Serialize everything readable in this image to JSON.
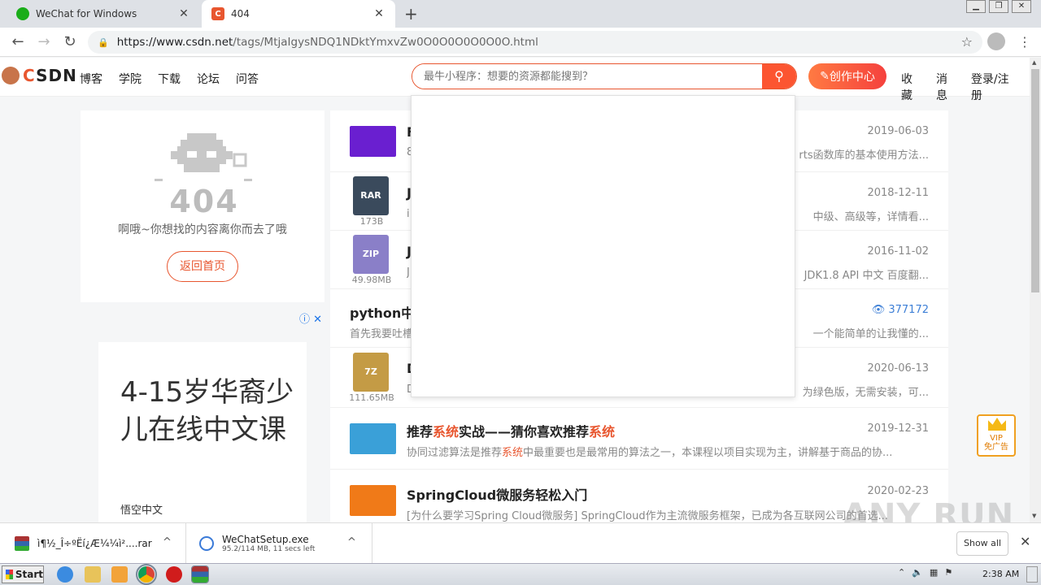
{
  "browser": {
    "tabs": [
      {
        "title": "WeChat for Windows"
      },
      {
        "title": "404"
      }
    ],
    "url_host": "https://www.csdn.net",
    "url_path": "/tags/MtjaIgysNDQ1NDktYmxvZw0O0O0O0O0O0O.html"
  },
  "header": {
    "logo": "CSDN",
    "nav": [
      "博客",
      "学院",
      "下载",
      "论坛",
      "问答"
    ],
    "search_placeholder": "最牛小程序：想要的资源都能搜到？",
    "create_label": "创作中心",
    "right_links": [
      "收藏",
      "消息",
      "登录/注册"
    ]
  },
  "error_card": {
    "code": "404",
    "message": "啊哦~你想找的内容离你而去了哦",
    "home_button": "返回首页"
  },
  "ad": {
    "headline": "4-15岁华裔少儿在线中文课",
    "brand": "悟空中文"
  },
  "results": [
    {
      "title": "F",
      "desc": "8",
      "desc_tail": "rts函数库的基本使用方法...",
      "date": "2019-06-03",
      "thumb_color": "#6a1fd0"
    },
    {
      "title": "J",
      "desc": "i",
      "desc_tail": "中级、高级等，详情看...",
      "date": "2018-12-11",
      "file_type": "RAR",
      "file_size": "173B",
      "file_color": "#3a4a5c"
    },
    {
      "title": "J",
      "desc": "J",
      "desc_tail": "JDK1.8 API 中文 百度翻...",
      "date": "2016-11-02",
      "file_type": "ZIP",
      "file_size": "49.98MB",
      "file_color": "#8a7fc8"
    },
    {
      "title": "python中",
      "desc": "首先我要吐槽",
      "desc_tail": "一个能简单的让我懂的...",
      "views": "377172"
    },
    {
      "title": "D",
      "desc": "D",
      "desc_tail": "为绿色版，无需安装，可...",
      "date": "2020-06-13",
      "file_type": "7Z",
      "file_size": "111.65MB",
      "file_color": "#c49b45"
    },
    {
      "title_parts": [
        "推荐",
        "系统",
        "实战——猜你喜欢推荐",
        "系统"
      ],
      "desc_parts": [
        "协同过滤算法是推荐",
        "系统",
        "中最重要也是最常用的算法之一，本课程以项目实现为主，讲解基于商品的协..."
      ],
      "date": "2019-12-31",
      "thumb_color": "#3aa0d8"
    },
    {
      "title": "SpringCloud微服务轻松入门",
      "desc": "[为什么要学习Spring Cloud微服务] SpringCloud作为主流微服务框架，已成为各互联网公司的首选...",
      "date": "2020-02-23",
      "thumb_color": "#f07a18"
    }
  ],
  "vip_badge": "VIP\n免广告",
  "downloads": [
    {
      "name": "ì¶½_Î÷ºËí¿Æ¼¼ì²....rar",
      "sub": ""
    },
    {
      "name": "WeChatSetup.exe",
      "sub": "95.2/114 MB, 11 secs left"
    }
  ],
  "show_all": "Show all",
  "taskbar": {
    "start": "Start",
    "clock": "2:38 AM"
  },
  "watermark": "ANY RUN"
}
